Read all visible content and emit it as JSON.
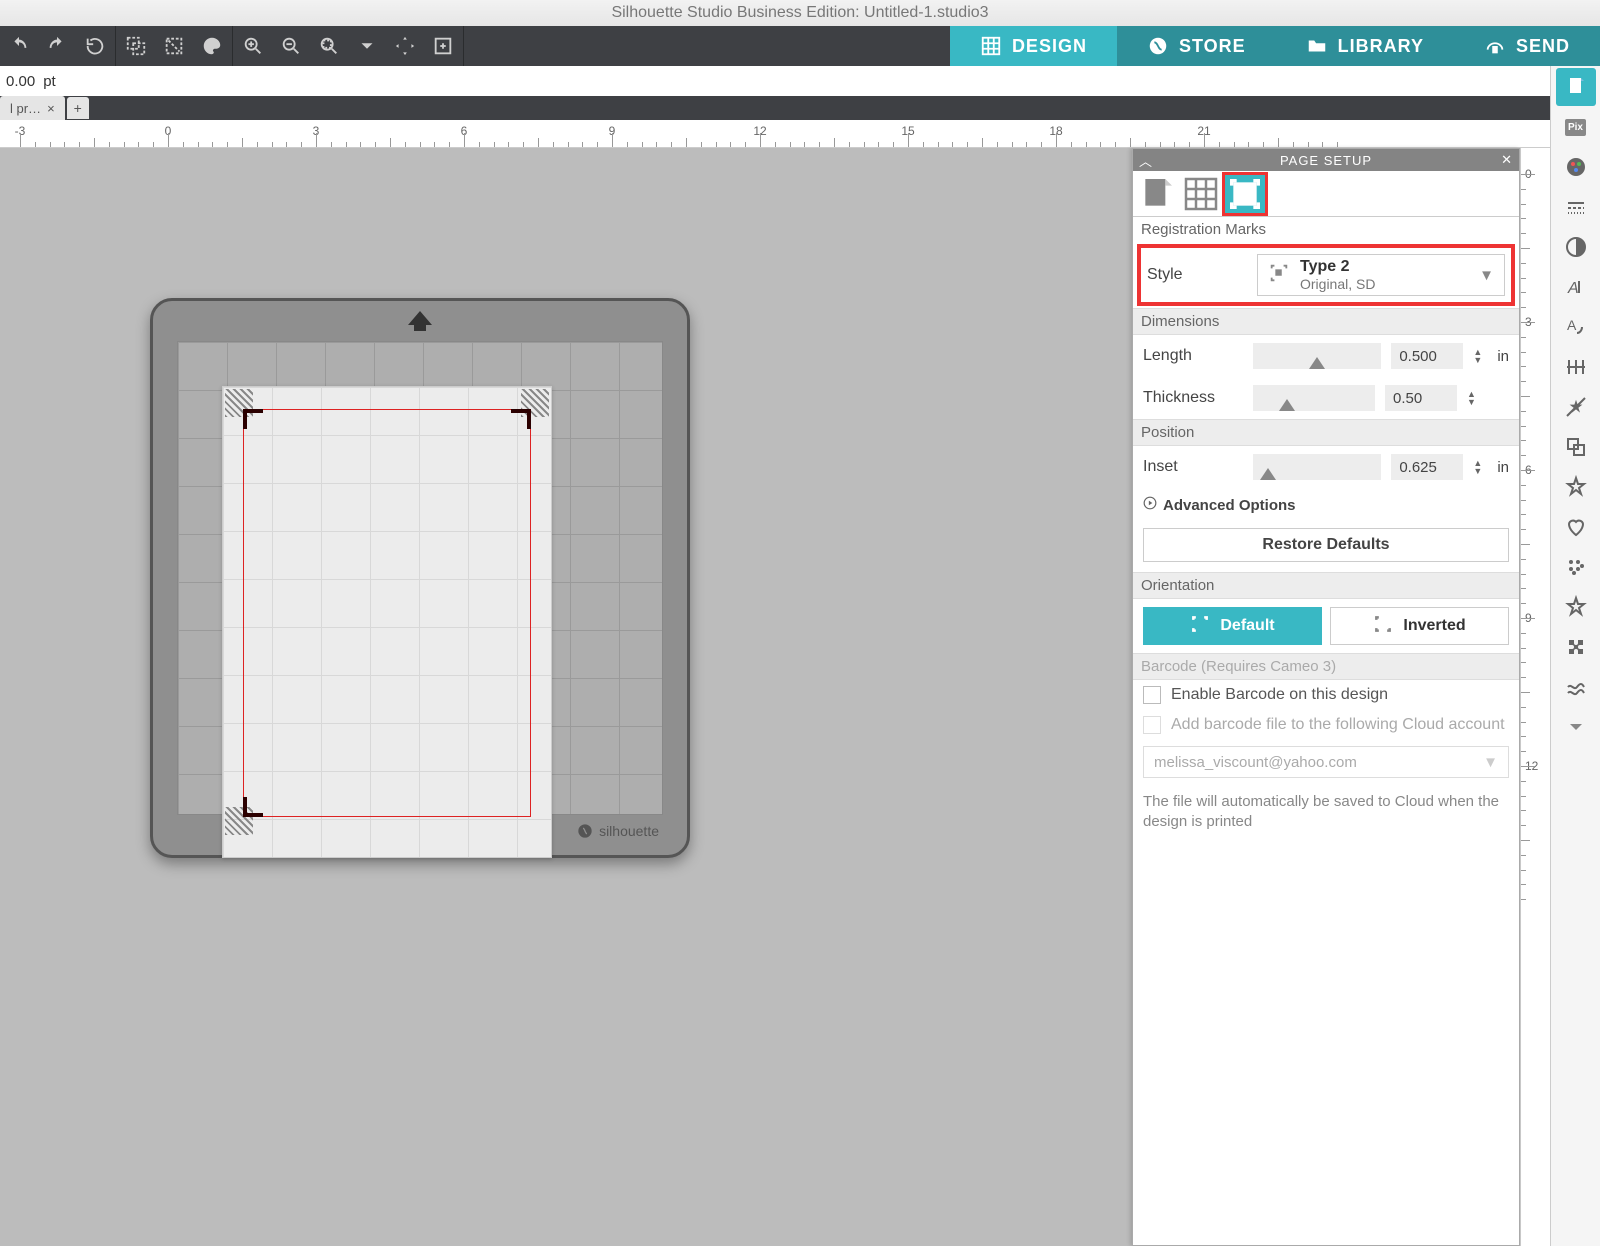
{
  "titlebar": "Silhouette Studio Business Edition: Untitled-1.studio3",
  "nav": {
    "design": "DESIGN",
    "store": "STORE",
    "library": "LIBRARY",
    "send": "SEND"
  },
  "secondbar": {
    "value": "0.00",
    "unit": "pt"
  },
  "doc_tab": {
    "label": "l pr…",
    "close": "×",
    "add": "+"
  },
  "ruler": {
    "marks": [
      "-3",
      "0",
      "3",
      "6",
      "9",
      "12",
      "15",
      "18",
      "21"
    ]
  },
  "vruler": {
    "marks": [
      "0",
      "3",
      "6",
      "9",
      "12"
    ]
  },
  "mat": {
    "brand": "silhouette"
  },
  "panel": {
    "title": "PAGE SETUP",
    "section_reg": "Registration Marks",
    "style_label": "Style",
    "style_value": "Type 2",
    "style_sub": "Original, SD",
    "section_dim": "Dimensions",
    "length_label": "Length",
    "length_val": "0.500",
    "length_unit": "in",
    "thickness_label": "Thickness",
    "thickness_val": "0.50",
    "section_pos": "Position",
    "inset_label": "Inset",
    "inset_val": "0.625",
    "inset_unit": "in",
    "advanced": "Advanced Options",
    "restore": "Restore Defaults",
    "section_orient": "Orientation",
    "orient_default": "Default",
    "orient_inverted": "Inverted",
    "barcode_header": "Barcode (Requires Cameo 3)",
    "barcode_enable": "Enable Barcode on this design",
    "barcode_cloud": "Add barcode file to the following Cloud account",
    "email": "melissa_viscount@yahoo.com",
    "note": "The file will automatically be saved to Cloud when the design is printed"
  }
}
